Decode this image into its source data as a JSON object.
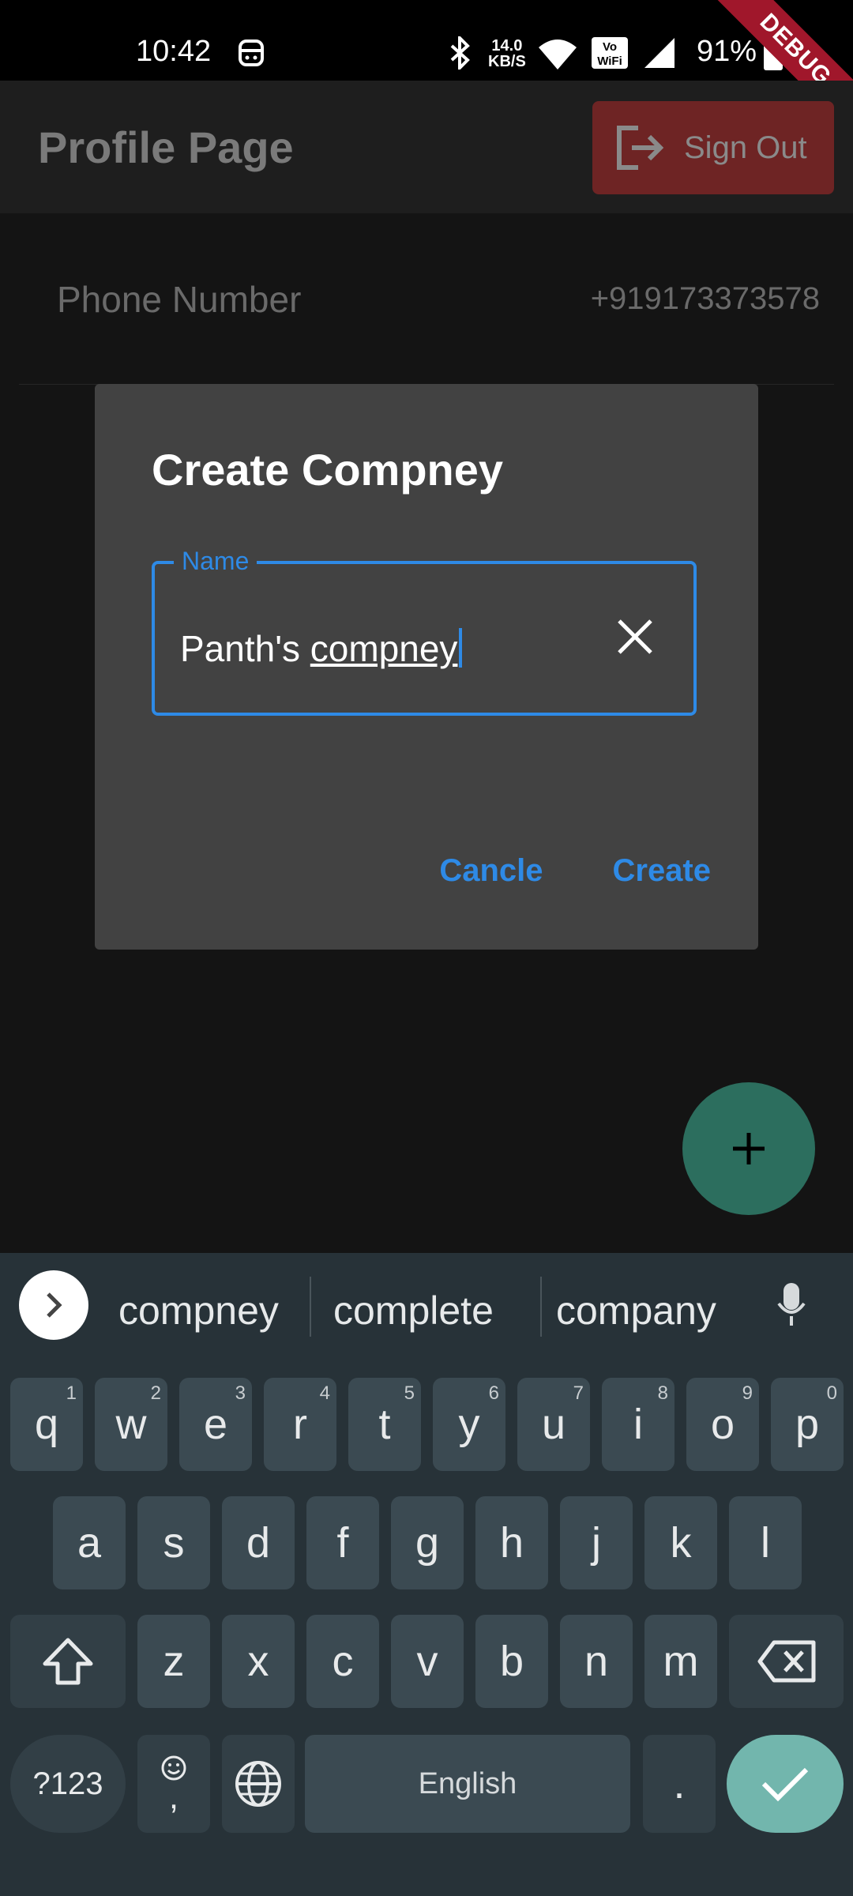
{
  "status_bar": {
    "time": "10:42",
    "net_speed_value": "14.0",
    "net_speed_unit": "KB/S",
    "battery": "91%",
    "debug_banner": "DEBUG"
  },
  "app_bar": {
    "title": "Profile Page",
    "sign_out_label": "Sign Out"
  },
  "profile": {
    "phone_label": "Phone Number",
    "phone_value": "+919173373578"
  },
  "dialog": {
    "title": "Create Compney",
    "field_label": "Name",
    "field_value_prefix": "Panth's ",
    "field_value_word": "compney",
    "cancel_label": "Cancle",
    "create_label": "Create"
  },
  "keyboard": {
    "suggestions": [
      "compney",
      "complete",
      "company"
    ],
    "row1": [
      {
        "key": "q",
        "hint": "1"
      },
      {
        "key": "w",
        "hint": "2"
      },
      {
        "key": "e",
        "hint": "3"
      },
      {
        "key": "r",
        "hint": "4"
      },
      {
        "key": "t",
        "hint": "5"
      },
      {
        "key": "y",
        "hint": "6"
      },
      {
        "key": "u",
        "hint": "7"
      },
      {
        "key": "i",
        "hint": "8"
      },
      {
        "key": "o",
        "hint": "9"
      },
      {
        "key": "p",
        "hint": "0"
      }
    ],
    "row2": [
      "a",
      "s",
      "d",
      "f",
      "g",
      "h",
      "j",
      "k",
      "l"
    ],
    "row3": [
      "z",
      "x",
      "c",
      "v",
      "b",
      "n",
      "m"
    ],
    "symbols_label": "?123",
    "comma_label": ",",
    "space_label": "English",
    "period_label": "."
  },
  "colors": {
    "accent": "#2e8ae6",
    "dialog_bg": "#424242",
    "keyboard_bg": "#273238",
    "fab": "#2c6e5e",
    "sign_out_bg": "#6e2424"
  }
}
